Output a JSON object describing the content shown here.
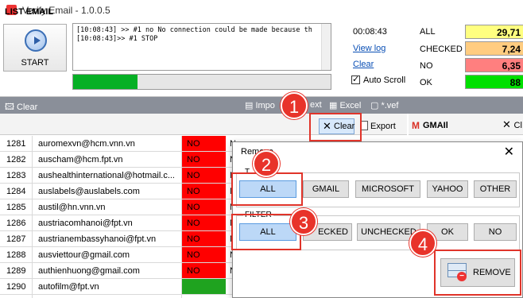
{
  "window": {
    "title": "Verify Email - 1.0.0.5"
  },
  "start": {
    "label": "START"
  },
  "log": {
    "lines": [
      "[10:08:43] >> #1 no No connection could be made because th",
      "[10:08:43]>> #1 STOP"
    ]
  },
  "progress": {
    "fraction": 0.25
  },
  "info": {
    "time": "00:08:43",
    "view_log": "View log",
    "clear": "Clear",
    "auto_scroll": "Auto Scroll"
  },
  "stats": [
    {
      "label": "ALL",
      "value": "29,71",
      "color": "#ffff80"
    },
    {
      "label": "CHECKED",
      "value": "7,24",
      "color": "#ffcc80"
    },
    {
      "label": "NO",
      "value": "6,35",
      "color": "#ff7f7f"
    },
    {
      "label": "OK",
      "value": "88",
      "color": "#00e000"
    }
  ],
  "toolbar": {
    "clear": "Clear",
    "import": "Impo",
    "import_suffix": "ext",
    "excel": "Excel",
    "vef": "*.vef"
  },
  "list": {
    "title": "LIST EMAIL",
    "clear_btn": "Clear",
    "export_btn": "Export"
  },
  "gmail_panel": {
    "title": "GMAIl",
    "clear": "Cl"
  },
  "rows": [
    {
      "id": "1281",
      "email": "auromexvn@hcm.vnn.vn",
      "status": "NO",
      "extra": "N"
    },
    {
      "id": "1282",
      "email": "auscham@hcm.fpt.vn",
      "status": "NO",
      "extra": "N"
    },
    {
      "id": "1283",
      "email": "aushealthinternational@hotmail.c...",
      "status": "NO",
      "extra": "N"
    },
    {
      "id": "1284",
      "email": "auslabels@auslabels.com",
      "status": "NO",
      "extra": "N"
    },
    {
      "id": "1285",
      "email": "austil@hn.vnn.vn",
      "status": "NO",
      "extra": "N"
    },
    {
      "id": "1286",
      "email": "austriacomhanoi@fpt.vn",
      "status": "NO",
      "extra": "N"
    },
    {
      "id": "1287",
      "email": "austrianembassyhanoi@fpt.vn",
      "status": "NO",
      "extra": "N"
    },
    {
      "id": "1288",
      "email": "ausviettour@gmail.com",
      "status": "NO",
      "extra": "N"
    },
    {
      "id": "1289",
      "email": "authienhuong@gmail.com",
      "status": "NO",
      "extra": "N"
    },
    {
      "id": "1290",
      "email": "autofilm@fpt.vn",
      "status": "",
      "extra": ""
    }
  ],
  "dialog": {
    "title": "Remove",
    "type_legend": "T",
    "type_buttons": [
      "ALL",
      "GMAIL",
      "MICROSOFT",
      "YAHOO",
      "OTHER"
    ],
    "filter_legend": "FILTER",
    "filter_buttons": [
      "ALL",
      "ECKED",
      "UNCHECKED",
      "OK",
      "NO"
    ],
    "remove": "REMOVE"
  },
  "annotations": [
    "1",
    "2",
    "3",
    "4"
  ]
}
